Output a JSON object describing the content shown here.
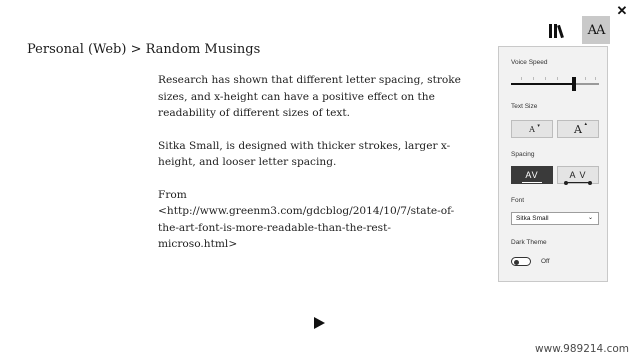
{
  "toolbar": {
    "close_symbol": "✕",
    "library_icon": "library-icon",
    "text_options_symbol": "AA"
  },
  "breadcrumb": "Personal (Web) > Random Musings",
  "article": {
    "paragraphs": [
      "Research has shown that different letter spacing, stroke sizes, and x-height can have a positive effect on the readability of different sizes of text.",
      "Sitka Small, is designed with thicker strokes, larger x-height, and looser letter spacing.",
      "From <http://www.greenm3.com/gdcblog/2014/10/7/state-of-the-art-font-is-more-readable-than-the-rest-microso.html>"
    ]
  },
  "player": {
    "play_icon": "play-icon"
  },
  "panel": {
    "voice_speed": {
      "label": "Voice Speed",
      "value": 0.72
    },
    "text_size": {
      "label": "Text Size",
      "decrease_glyph": "A",
      "increase_glyph": "A"
    },
    "spacing": {
      "label": "Spacing",
      "narrow_glyph": "AV",
      "wide_glyph": "A V",
      "selected": "narrow"
    },
    "font": {
      "label": "Font",
      "selected": "Sitka Small"
    },
    "dark_theme": {
      "label": "Dark Theme",
      "state_text": "Off",
      "on": false
    }
  },
  "watermark": "www.989214.com"
}
